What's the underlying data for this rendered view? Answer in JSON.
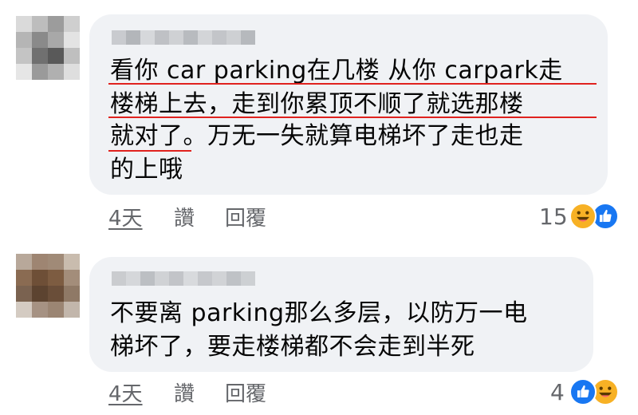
{
  "comments": [
    {
      "lines": [
        "看你 car parking在几楼 从你 carpark走",
        "楼梯上去，走到你累顶不顺了就选那楼",
        "就对了。万无一失就算电梯坏了走也走",
        "的上哦"
      ],
      "time": "4天",
      "like_label": "讚",
      "reply_label": "回覆",
      "reaction_count": "15",
      "reactions": [
        "haha-icon",
        "like-icon"
      ]
    },
    {
      "lines": [
        "不要离 parking那么多层，以防万一电",
        "梯坏了，要走楼梯都不会走到半死"
      ],
      "time": "4天",
      "like_label": "讚",
      "reply_label": "回覆",
      "reaction_count": "4",
      "reactions": [
        "like-icon",
        "haha-icon"
      ]
    }
  ],
  "colors": {
    "bubble": "#f0f2f5",
    "meta_text": "#65676b",
    "underline": "#e0221e",
    "like": "#1877f2",
    "haha": "#f7b125"
  }
}
